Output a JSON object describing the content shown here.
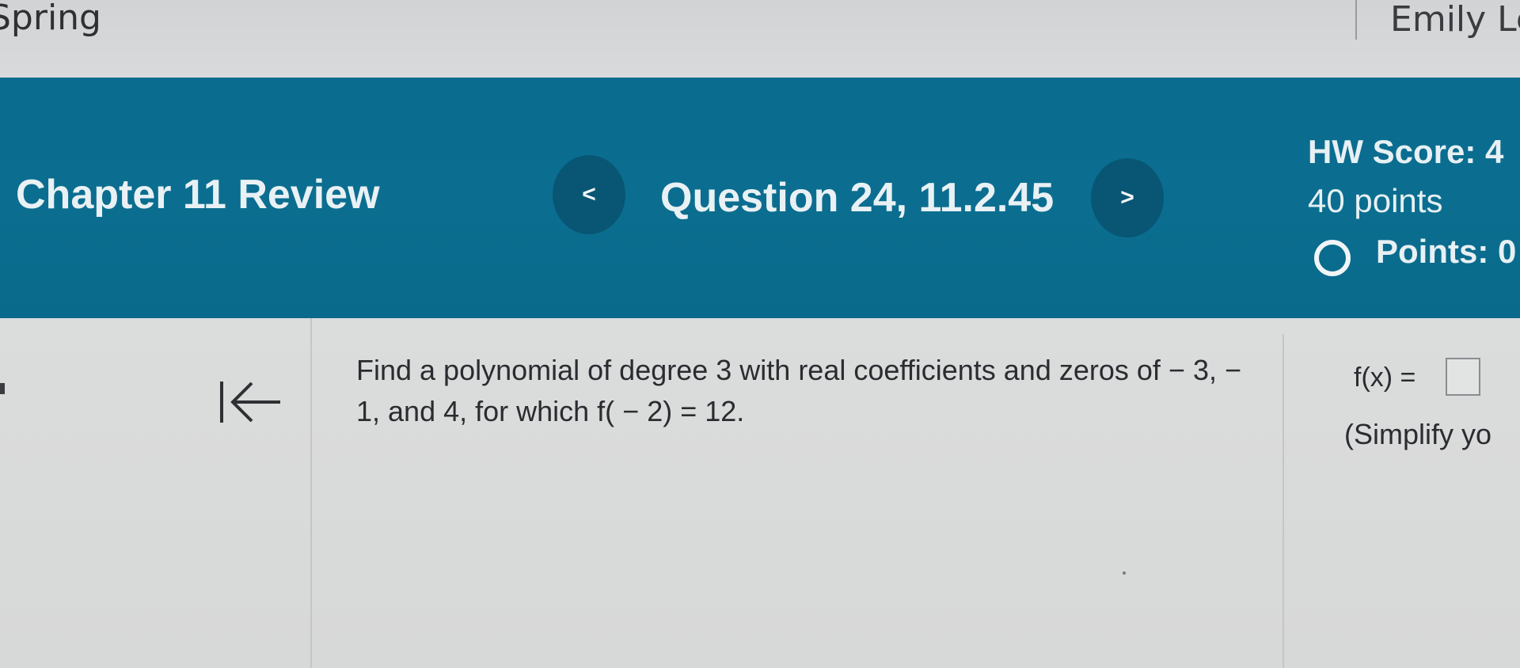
{
  "topbar": {
    "course": "Spring",
    "user": "Emily Le"
  },
  "header": {
    "chapter_title": "Chapter 11 Review",
    "prev_icon": "chevron-left-icon",
    "prev_glyph": "<",
    "question_title": "Question 24, 11.2.45",
    "next_icon": "chevron-right-icon",
    "next_glyph": ">",
    "hw_score": "HW Score: 4",
    "hw_points": "40 points",
    "points_label": "Points: 0"
  },
  "main": {
    "question_text": "Find a polynomial of degree 3 with real coefficients and zeros of − 3, − 1, and 4, for which f( − 2) = 12.",
    "answer_label": "f(x) =",
    "answer_value": "",
    "simplify_text": "(Simplify yo"
  },
  "colors": {
    "header_bg": "#0b6e90",
    "nav_button_bg": "#085673",
    "content_bg": "#d9dadb",
    "text": "#2a2c30"
  }
}
